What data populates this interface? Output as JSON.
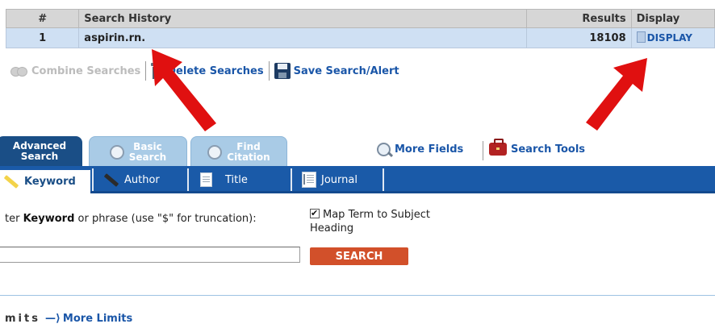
{
  "history_table": {
    "headers": {
      "num": "#",
      "history": "Search History",
      "results": "Results",
      "display": "Display"
    },
    "rows": [
      {
        "num": "1",
        "query": "aspirin.rn.",
        "results": "18108",
        "display": "DISPLAY"
      }
    ]
  },
  "actions": {
    "combine": "Combine Searches",
    "delete": "Delete Searches",
    "save": "Save Search/Alert"
  },
  "search_tabs": [
    {
      "label_line1": "Advanced",
      "label_line2": "Search",
      "active": true
    },
    {
      "label_line1": "Basic",
      "label_line2": "Search",
      "active": false
    },
    {
      "label_line1": "Find",
      "label_line2": "Citation",
      "active": false
    }
  ],
  "tools": {
    "more_fields": "More Fields",
    "search_tools": "Search Tools"
  },
  "field_tabs": {
    "keyword": "Keyword",
    "author": "Author",
    "title": "Title",
    "journal": "Journal"
  },
  "search_form": {
    "prompt_prefix": "ter ",
    "prompt_bold": "Keyword",
    "prompt_suffix": " or phrase (use \"$\" for truncation):",
    "map_term": "Map Term to Subject Heading",
    "input_value": "",
    "search_button": "SEARCH"
  },
  "limits": {
    "label": "mits",
    "more_limits": "More Limits"
  },
  "colors": {
    "accent_blue": "#1a5aa8",
    "tab_active": "#1a4e86",
    "search_button": "#d2502a",
    "arrow_red": "#e01010"
  }
}
